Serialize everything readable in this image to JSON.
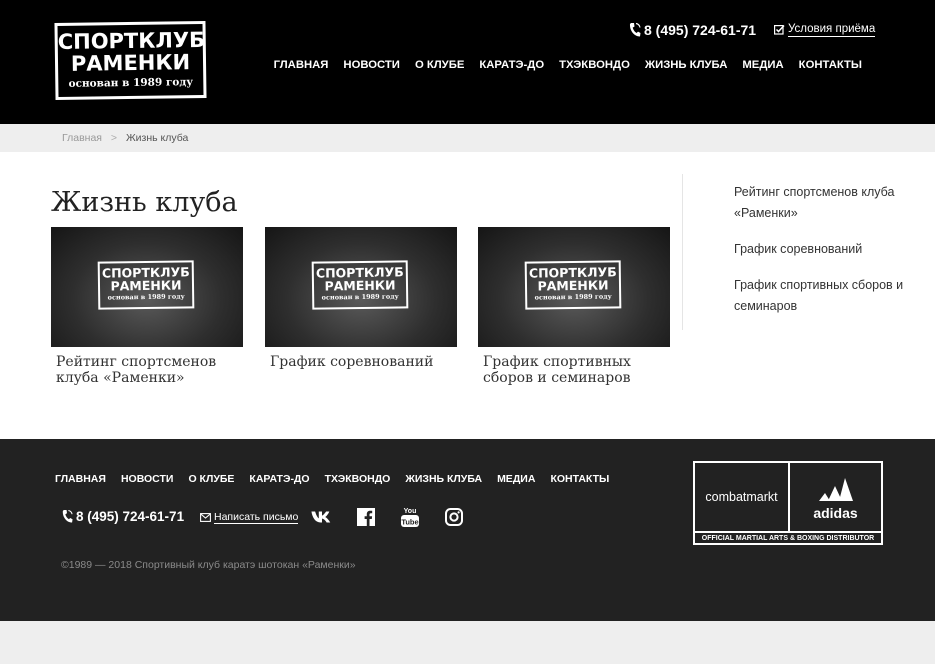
{
  "header": {
    "logo": {
      "line1": "СПОРТКЛУБ",
      "line2": "РАМЕНКИ",
      "line3": "основан в 1989 году"
    },
    "phone": "8 (495) 724-61-71",
    "terms_link": "Условия приёма",
    "nav": [
      "Главная",
      "Новости",
      "О клубе",
      "Каратэ-до",
      "Тхэквондо",
      "Жизнь клуба",
      "Медиа",
      "Контакты"
    ]
  },
  "breadcrumb": {
    "home": "Главная",
    "separator": ">",
    "current": "Жизнь клуба"
  },
  "main": {
    "title": "Жизнь клуба",
    "card_logo": {
      "line1": "СПОРТКЛУБ",
      "line2": "РАМЕНКИ",
      "line3": "основан в 1989 году"
    },
    "cards": [
      {
        "title": "Рейтинг спортсменов клуба «Раменки»"
      },
      {
        "title": "График соревнований"
      },
      {
        "title": "График спортивных сборов и семинаров"
      }
    ]
  },
  "sidebar": {
    "links": [
      "Рейтинг спортсменов клуба «Раменки»",
      "График соревнований",
      "График спортивных сборов и семинаров"
    ]
  },
  "footer": {
    "nav": [
      "Главная",
      "Новости",
      "О клубе",
      "Каратэ-до",
      "Тхэквондо",
      "Жизнь клуба",
      "Медиа",
      "Контакты"
    ],
    "phone": "8 (495) 724-61-71",
    "mail_link": "Написать письмо",
    "social": [
      "vk-icon",
      "facebook-icon",
      "youtube-icon",
      "instagram-icon"
    ],
    "copyright": "©1989 — 2018 Спортивный клуб каратэ шотокан «Раменки»",
    "partner": {
      "left": "combatmarkt",
      "right": "adidas",
      "bottom": "OFFICIAL MARTIAL ARTS & BOXING DISTRIBUTOR"
    }
  },
  "colors": {
    "header_bg": "#000000",
    "footer_bg": "#222222",
    "breadcrumb_bg": "#eeeeee",
    "text": "#222222"
  }
}
